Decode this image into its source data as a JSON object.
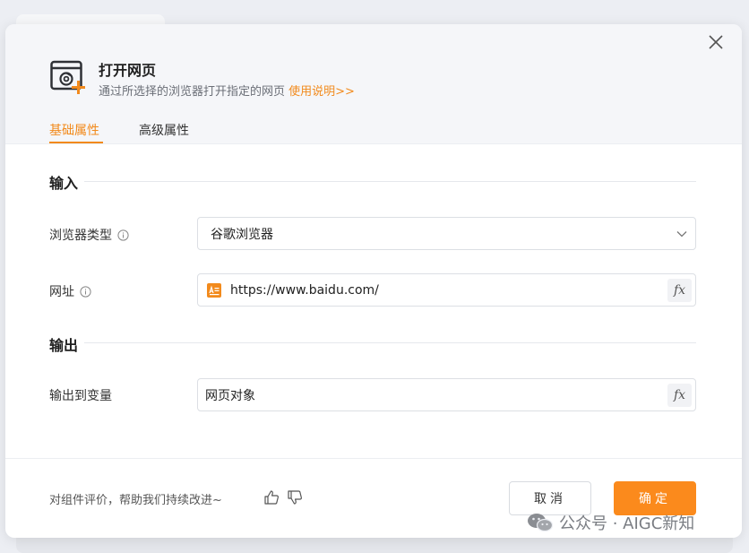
{
  "dialog": {
    "title": "打开网页",
    "subtitle": "通过所选择的浏览器打开指定的网页",
    "help_link": "使用说明>>",
    "tabs": [
      {
        "label": "基础属性",
        "active": true
      },
      {
        "label": "高级属性",
        "active": false
      }
    ]
  },
  "input_section": {
    "title": "输入",
    "browser_type": {
      "label": "浏览器类型",
      "value": "谷歌浏览器"
    },
    "url": {
      "label": "网址",
      "value": "https://www.baidu.com/",
      "fx_label": "fx"
    }
  },
  "output_section": {
    "title": "输出",
    "variable": {
      "label": "输出到变量",
      "value": "网页对象",
      "fx_label": "fx"
    }
  },
  "footer": {
    "feedback_text": "对组件评价，帮助我们持续改进~",
    "cancel_label": "取消",
    "ok_label": "确定"
  },
  "watermark": {
    "text": "公众号 · AIGC新知"
  },
  "colors": {
    "accent": "#f28a1c",
    "primary_button": "#fb8a1c"
  },
  "icons": [
    "close-icon",
    "open-webpage-icon",
    "info-icon",
    "chevron-down-icon",
    "url-variable-icon",
    "thumbs-up-icon",
    "thumbs-down-icon",
    "wechat-icon"
  ]
}
